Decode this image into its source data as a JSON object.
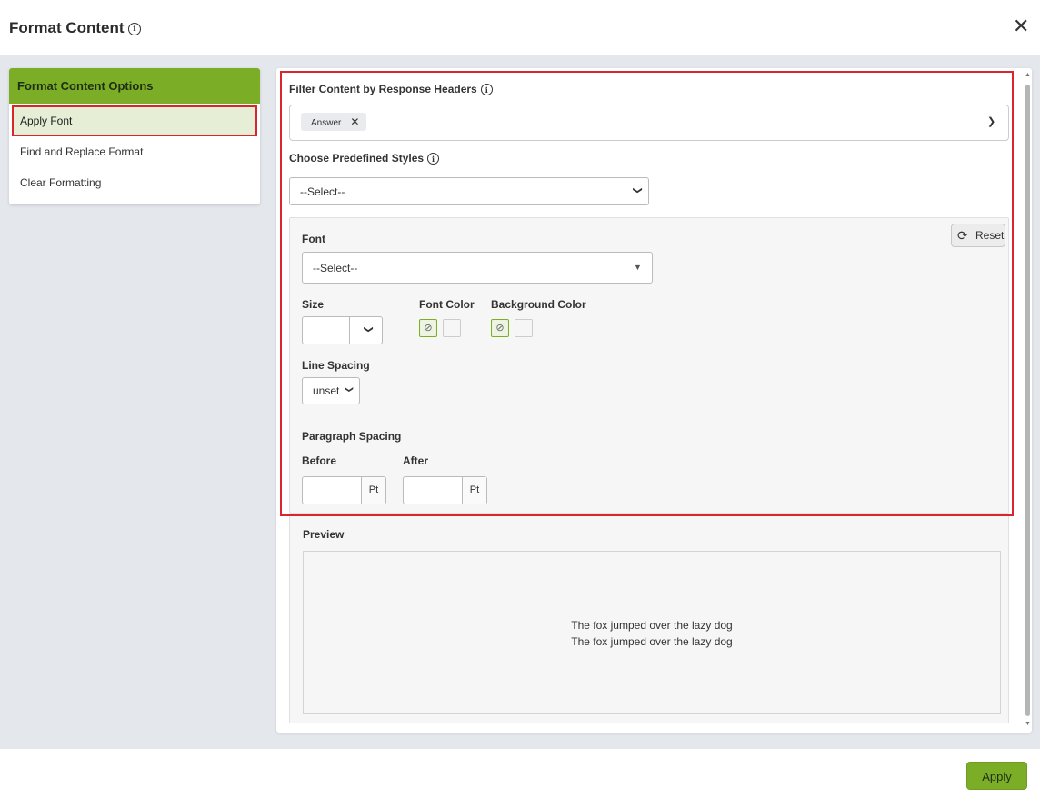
{
  "dialog": {
    "title": "Format Content",
    "info_icon": "info-icon",
    "close_icon": "close-icon"
  },
  "sidebar": {
    "header": "Format Content Options",
    "items": [
      {
        "label": "Apply Font",
        "active": true
      },
      {
        "label": "Find and Replace Format",
        "active": false
      },
      {
        "label": "Clear Formatting",
        "active": false
      }
    ]
  },
  "filter": {
    "label": "Filter Content by Response Headers",
    "chips": [
      {
        "label": "Answer",
        "remove_icon": "close-icon"
      }
    ]
  },
  "predefined": {
    "label": "Choose Predefined Styles",
    "value": "--Select--"
  },
  "font_section": {
    "reset_label": "Reset",
    "font_label": "Font",
    "font_value": "--Select--",
    "size_label": "Size",
    "size_value": "",
    "font_color_label": "Font Color",
    "background_color_label": "Background Color",
    "line_spacing_label": "Line Spacing",
    "line_spacing_value": "unset",
    "paragraph_spacing_label": "Paragraph Spacing",
    "before_label": "Before",
    "after_label": "After",
    "before_value": "",
    "after_value": "",
    "unit": "Pt"
  },
  "preview": {
    "label": "Preview",
    "lines": [
      "The fox jumped over the lazy dog",
      "The fox jumped over the lazy dog"
    ]
  },
  "footer": {
    "apply_label": "Apply"
  },
  "colors": {
    "accent_green": "#7bad27",
    "highlight_red": "#d9262c",
    "body_bg": "#e4e7ec"
  }
}
